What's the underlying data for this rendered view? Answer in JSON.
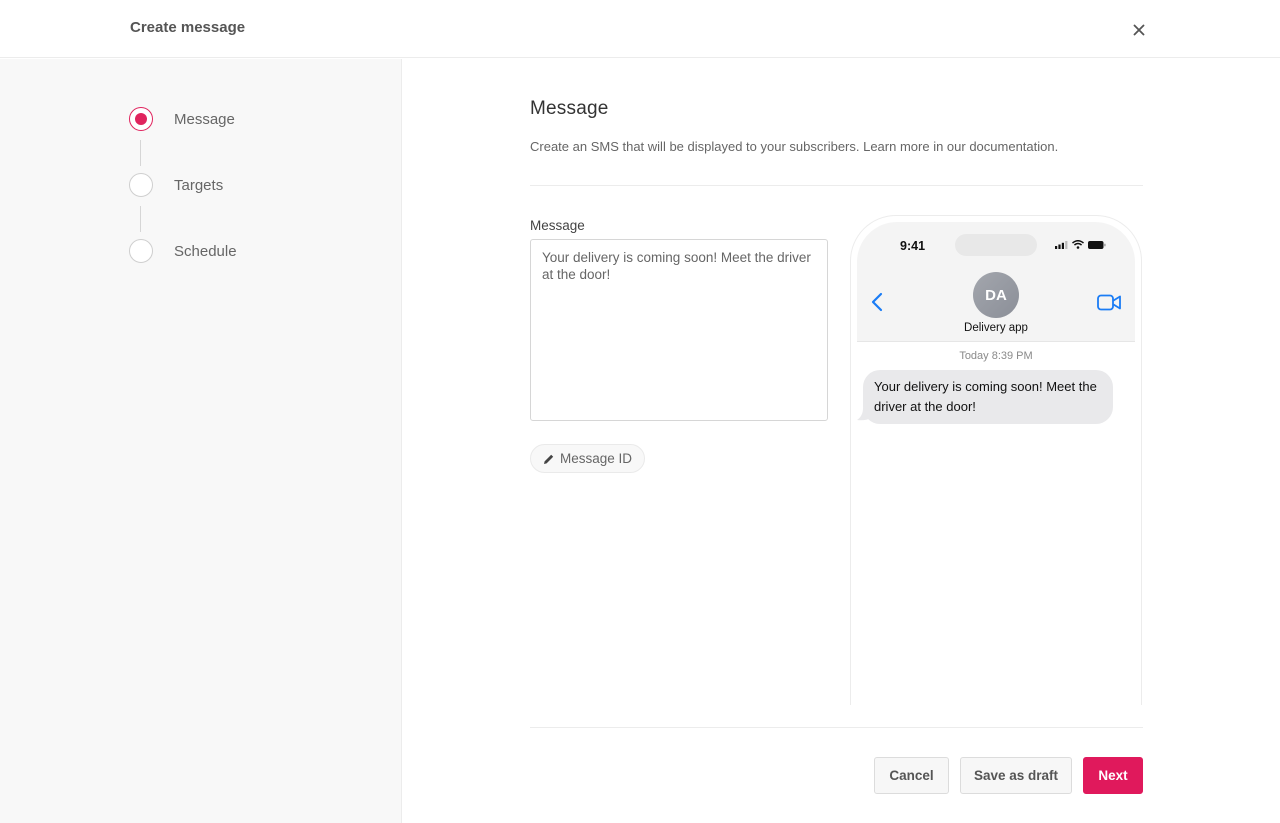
{
  "header": {
    "title": "Create message",
    "close_icon": "close-icon"
  },
  "steps": [
    {
      "label": "Message",
      "state": "active"
    },
    {
      "label": "Targets",
      "state": "pending"
    },
    {
      "label": "Schedule",
      "state": "pending"
    }
  ],
  "main": {
    "title": "Message",
    "description": "Create an SMS that will be displayed to your subscribers. Learn more in our documentation.",
    "message_field": {
      "label": "Message",
      "value": "Your delivery is coming soon! Meet the driver at the door!"
    },
    "message_id_button": {
      "label": "Message ID",
      "icon": "pencil-icon"
    }
  },
  "preview": {
    "status_time": "9:41",
    "avatar_initials": "DA",
    "contact_name": "Delivery app",
    "timestamp": "Today 8:39 PM",
    "bubble_text": "Your delivery is coming soon! Meet the driver at the door!",
    "accent_color": "#1a7cf5"
  },
  "footer": {
    "cancel_label": "Cancel",
    "draft_label": "Save as draft",
    "next_label": "Next"
  },
  "colors": {
    "brand": "#e0195c",
    "step_active": "#e0245e"
  }
}
